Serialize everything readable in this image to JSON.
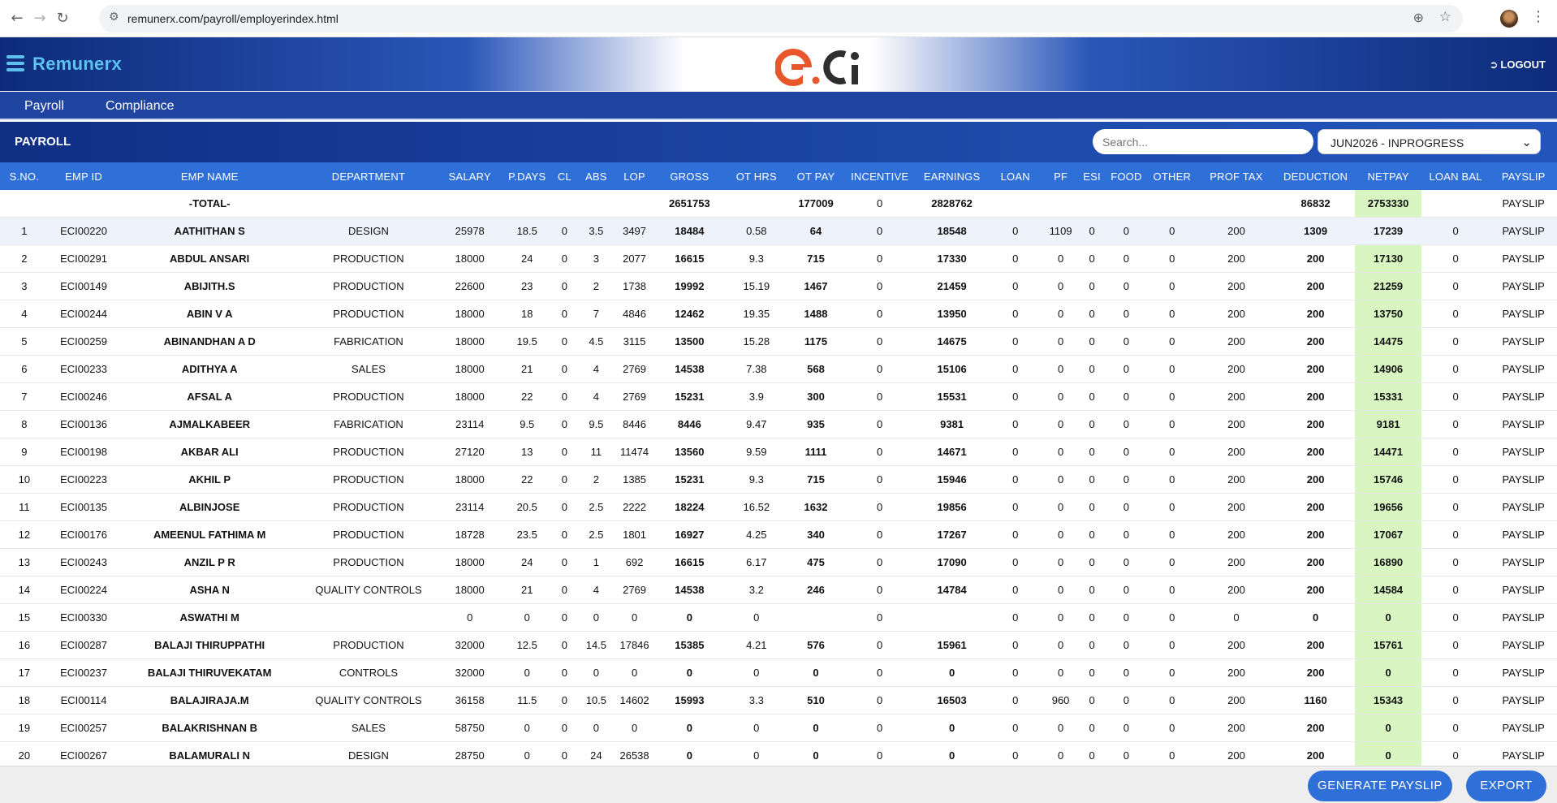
{
  "browser": {
    "url": "remunerx.com/payroll/employerindex.html",
    "back_icon": "arrow-left-icon",
    "forward_icon": "arrow-right-icon",
    "reload_icon": "reload-icon"
  },
  "header": {
    "brand": "Remunerx",
    "logo_text": "eci",
    "logout_label": "LOGOUT"
  },
  "menu": {
    "items": [
      "Payroll",
      "Compliance"
    ]
  },
  "payroll_bar": {
    "title": "PAYROLL",
    "search_placeholder": "Search...",
    "period_selected": "JUN2026 - INPROGRESS"
  },
  "table": {
    "columns": [
      "S.NO.",
      "EMP ID",
      "EMP NAME",
      "DEPARTMENT",
      "SALARY",
      "P.DAYS",
      "CL",
      "ABS",
      "LOP",
      "GROSS",
      "OT HRS",
      "OT PAY",
      "INCENTIVE",
      "EARNINGS",
      "LOAN",
      "PF",
      "ESI",
      "FOOD",
      "OTHER",
      "PROF TAX",
      "DEDUCTION",
      "NETPAY",
      "LOAN BAL",
      "PAYSLIP"
    ],
    "total_row": [
      "",
      "",
      "-TOTAL-",
      "",
      "",
      "",
      "",
      "",
      "",
      "2651753",
      "",
      "177009",
      "0",
      "2828762",
      "",
      "",
      "",
      "",
      "",
      "",
      "86832",
      "2753330",
      "",
      "PAYSLIP"
    ],
    "rows": [
      [
        "1",
        "ECI00220",
        "AATHITHAN S",
        "DESIGN",
        "25978",
        "18.5",
        "0",
        "3.5",
        "3497",
        "18484",
        "0.58",
        "64",
        "0",
        "18548",
        "0",
        "1109",
        "0",
        "0",
        "0",
        "200",
        "1309",
        "17239",
        "0",
        "PAYSLIP"
      ],
      [
        "2",
        "ECI00291",
        "ABDUL ANSARI",
        "PRODUCTION",
        "18000",
        "24",
        "0",
        "3",
        "2077",
        "16615",
        "9.3",
        "715",
        "0",
        "17330",
        "0",
        "0",
        "0",
        "0",
        "0",
        "200",
        "200",
        "17130",
        "0",
        "PAYSLIP"
      ],
      [
        "3",
        "ECI00149",
        "ABIJITH.S",
        "PRODUCTION",
        "22600",
        "23",
        "0",
        "2",
        "1738",
        "19992",
        "15.19",
        "1467",
        "0",
        "21459",
        "0",
        "0",
        "0",
        "0",
        "0",
        "200",
        "200",
        "21259",
        "0",
        "PAYSLIP"
      ],
      [
        "4",
        "ECI00244",
        "ABIN V A",
        "PRODUCTION",
        "18000",
        "18",
        "0",
        "7",
        "4846",
        "12462",
        "19.35",
        "1488",
        "0",
        "13950",
        "0",
        "0",
        "0",
        "0",
        "0",
        "200",
        "200",
        "13750",
        "0",
        "PAYSLIP"
      ],
      [
        "5",
        "ECI00259",
        "ABINANDHAN A D",
        "FABRICATION",
        "18000",
        "19.5",
        "0",
        "4.5",
        "3115",
        "13500",
        "15.28",
        "1175",
        "0",
        "14675",
        "0",
        "0",
        "0",
        "0",
        "0",
        "200",
        "200",
        "14475",
        "0",
        "PAYSLIP"
      ],
      [
        "6",
        "ECI00233",
        "ADITHYA A",
        "SALES",
        "18000",
        "21",
        "0",
        "4",
        "2769",
        "14538",
        "7.38",
        "568",
        "0",
        "15106",
        "0",
        "0",
        "0",
        "0",
        "0",
        "200",
        "200",
        "14906",
        "0",
        "PAYSLIP"
      ],
      [
        "7",
        "ECI00246",
        "AFSAL A",
        "PRODUCTION",
        "18000",
        "22",
        "0",
        "4",
        "2769",
        "15231",
        "3.9",
        "300",
        "0",
        "15531",
        "0",
        "0",
        "0",
        "0",
        "0",
        "200",
        "200",
        "15331",
        "0",
        "PAYSLIP"
      ],
      [
        "8",
        "ECI00136",
        "AJMALKABEER",
        "FABRICATION",
        "23114",
        "9.5",
        "0",
        "9.5",
        "8446",
        "8446",
        "9.47",
        "935",
        "0",
        "9381",
        "0",
        "0",
        "0",
        "0",
        "0",
        "200",
        "200",
        "9181",
        "0",
        "PAYSLIP"
      ],
      [
        "9",
        "ECI00198",
        "AKBAR ALI",
        "PRODUCTION",
        "27120",
        "13",
        "0",
        "11",
        "11474",
        "13560",
        "9.59",
        "1111",
        "0",
        "14671",
        "0",
        "0",
        "0",
        "0",
        "0",
        "200",
        "200",
        "14471",
        "0",
        "PAYSLIP"
      ],
      [
        "10",
        "ECI00223",
        "AKHIL P",
        "PRODUCTION",
        "18000",
        "22",
        "0",
        "2",
        "1385",
        "15231",
        "9.3",
        "715",
        "0",
        "15946",
        "0",
        "0",
        "0",
        "0",
        "0",
        "200",
        "200",
        "15746",
        "0",
        "PAYSLIP"
      ],
      [
        "11",
        "ECI00135",
        "ALBINJOSE",
        "PRODUCTION",
        "23114",
        "20.5",
        "0",
        "2.5",
        "2222",
        "18224",
        "16.52",
        "1632",
        "0",
        "19856",
        "0",
        "0",
        "0",
        "0",
        "0",
        "200",
        "200",
        "19656",
        "0",
        "PAYSLIP"
      ],
      [
        "12",
        "ECI00176",
        "AMEENUL FATHIMA M",
        "PRODUCTION",
        "18728",
        "23.5",
        "0",
        "2.5",
        "1801",
        "16927",
        "4.25",
        "340",
        "0",
        "17267",
        "0",
        "0",
        "0",
        "0",
        "0",
        "200",
        "200",
        "17067",
        "0",
        "PAYSLIP"
      ],
      [
        "13",
        "ECI00243",
        "ANZIL P R",
        "PRODUCTION",
        "18000",
        "24",
        "0",
        "1",
        "692",
        "16615",
        "6.17",
        "475",
        "0",
        "17090",
        "0",
        "0",
        "0",
        "0",
        "0",
        "200",
        "200",
        "16890",
        "0",
        "PAYSLIP"
      ],
      [
        "14",
        "ECI00224",
        "ASHA N",
        "QUALITY CONTROLS",
        "18000",
        "21",
        "0",
        "4",
        "2769",
        "14538",
        "3.2",
        "246",
        "0",
        "14784",
        "0",
        "0",
        "0",
        "0",
        "0",
        "200",
        "200",
        "14584",
        "0",
        "PAYSLIP"
      ],
      [
        "15",
        "ECI00330",
        "ASWATHI M",
        "",
        "0",
        "0",
        "0",
        "0",
        "0",
        "0",
        "0",
        "",
        "0",
        "",
        "0",
        "0",
        "0",
        "0",
        "0",
        "0",
        "0",
        "0",
        "0",
        "PAYSLIP"
      ],
      [
        "16",
        "ECI00287",
        "BALAJI THIRUPPATHI",
        "PRODUCTION",
        "32000",
        "12.5",
        "0",
        "14.5",
        "17846",
        "15385",
        "4.21",
        "576",
        "0",
        "15961",
        "0",
        "0",
        "0",
        "0",
        "0",
        "200",
        "200",
        "15761",
        "0",
        "PAYSLIP"
      ],
      [
        "17",
        "ECI00237",
        "BALAJI THIRUVEKATAM",
        "CONTROLS",
        "32000",
        "0",
        "0",
        "0",
        "0",
        "0",
        "0",
        "0",
        "0",
        "0",
        "0",
        "0",
        "0",
        "0",
        "0",
        "200",
        "200",
        "0",
        "0",
        "PAYSLIP"
      ],
      [
        "18",
        "ECI00114",
        "BALAJIRAJA.M",
        "QUALITY CONTROLS",
        "36158",
        "11.5",
        "0",
        "10.5",
        "14602",
        "15993",
        "3.3",
        "510",
        "0",
        "16503",
        "0",
        "960",
        "0",
        "0",
        "0",
        "200",
        "1160",
        "15343",
        "0",
        "PAYSLIP"
      ],
      [
        "19",
        "ECI00257",
        "BALAKRISHNAN B",
        "SALES",
        "58750",
        "0",
        "0",
        "0",
        "0",
        "0",
        "0",
        "0",
        "0",
        "0",
        "0",
        "0",
        "0",
        "0",
        "0",
        "200",
        "200",
        "0",
        "0",
        "PAYSLIP"
      ],
      [
        "20",
        "ECI00267",
        "BALAMURALI N",
        "DESIGN",
        "28750",
        "0",
        "0",
        "24",
        "26538",
        "0",
        "0",
        "0",
        "0",
        "0",
        "0",
        "0",
        "0",
        "0",
        "0",
        "200",
        "200",
        "0",
        "0",
        "PAYSLIP"
      ]
    ]
  },
  "footer": {
    "generate_label": "GENERATE PAYSLIP",
    "export_label": "EXPORT"
  },
  "colors": {
    "header_blue": "#0d2b7a",
    "table_header": "#2f6fd8",
    "netpay_highlight": "#d8f5c2",
    "brand_text": "#5fc1f0",
    "logo_orange": "#e8572b"
  }
}
